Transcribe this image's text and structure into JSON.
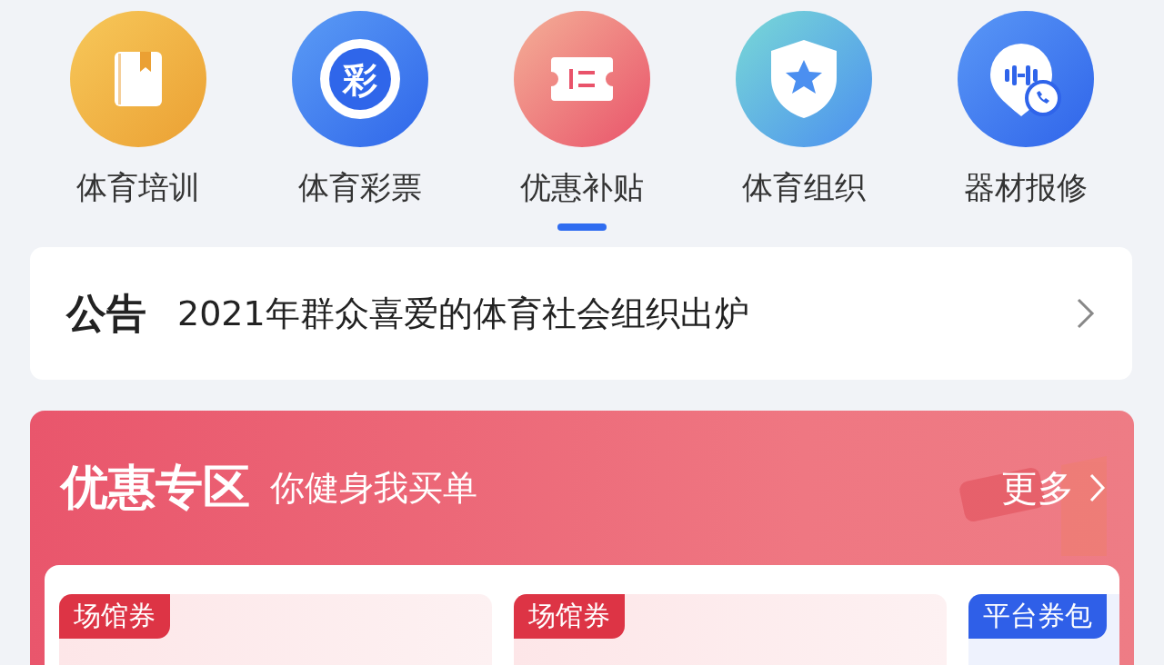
{
  "categories": [
    {
      "label": "体育培训",
      "kind": "book"
    },
    {
      "label": "体育彩票",
      "kind": "lottery",
      "icon_text": "彩"
    },
    {
      "label": "优惠补贴",
      "kind": "ticket"
    },
    {
      "label": "体育组织",
      "kind": "shield"
    },
    {
      "label": "器材报修",
      "kind": "support"
    }
  ],
  "pager": [
    {
      "selected": true
    }
  ],
  "notice": {
    "label": "公告",
    "text": "2021年群众喜爱的体育社会组织出炉"
  },
  "promo": {
    "title": "优惠专区",
    "subtitle": "你健身我买单",
    "more": "更多",
    "coupons": [
      {
        "tag": "场馆券",
        "kind": "venue"
      },
      {
        "tag": "场馆券",
        "kind": "venue"
      },
      {
        "tag": "平台券包",
        "kind": "platform"
      }
    ]
  }
}
